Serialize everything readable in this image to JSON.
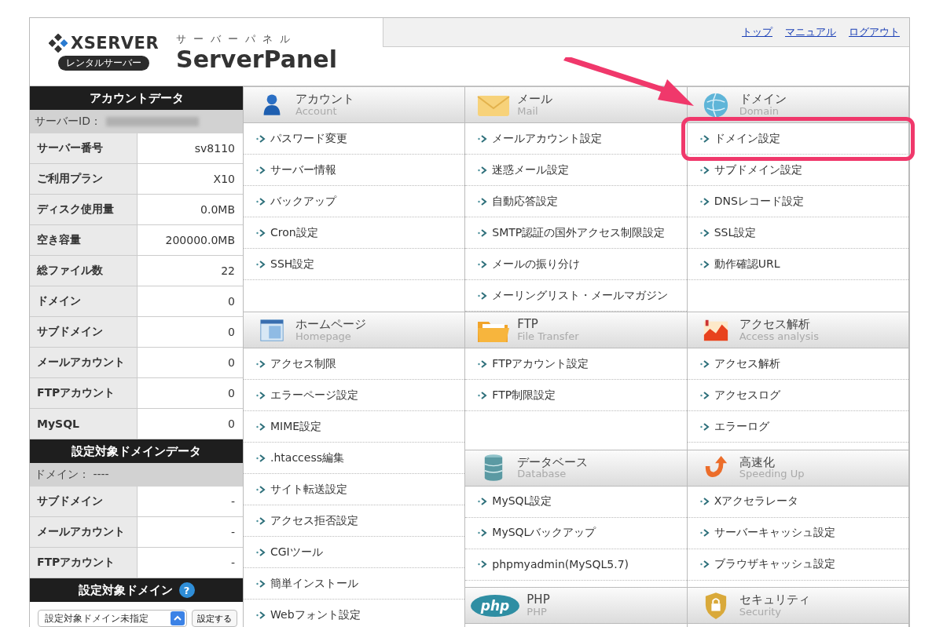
{
  "logo": {
    "brand": "XSERVER",
    "badge": "レンタルサーバー",
    "kana": "サーバーパネル",
    "product": "ServerPanel"
  },
  "top_links": [
    "トップ",
    "マニュアル",
    "ログアウト"
  ],
  "sidebar": [
    {
      "title": "アカウントデータ",
      "id_label": "サーバーID：",
      "id_redacted": true,
      "rows": [
        {
          "label": "サーバー番号",
          "value": "sv8110"
        },
        {
          "label": "ご利用プラン",
          "value": "X10"
        },
        {
          "label": "ディスク使用量",
          "value": "0.0MB"
        },
        {
          "label": "空き容量",
          "value": "200000.0MB"
        },
        {
          "label": "総ファイル数",
          "value": "22"
        },
        {
          "label": "ドメイン",
          "value": "0"
        },
        {
          "label": "サブドメイン",
          "value": "0"
        },
        {
          "label": "メールアカウント",
          "value": "0"
        },
        {
          "label": "FTPアカウント",
          "value": "0"
        },
        {
          "label": "MySQL",
          "value": "0"
        }
      ]
    },
    {
      "title": "設定対象ドメインデータ",
      "id_label": "ドメイン： ----",
      "id_redacted": false,
      "rows": [
        {
          "label": "サブドメイン",
          "value": "-"
        },
        {
          "label": "メールアカウント",
          "value": "-"
        },
        {
          "label": "FTPアカウント",
          "value": "-"
        }
      ]
    }
  ],
  "domain_picker": {
    "title": "設定対象ドメイン",
    "help": "?",
    "select_value": "設定対象ドメイン未指定",
    "button": "設定する"
  },
  "menu_columns": [
    [
      {
        "title": "アカウント",
        "subtitle": "Account",
        "items": [
          {
            "label": "パスワード変更",
            "highlighted": false
          },
          {
            "label": "サーバー情報",
            "highlighted": false
          },
          {
            "label": "バックアップ",
            "highlighted": false
          },
          {
            "label": "Cron設定",
            "highlighted": false
          },
          {
            "label": "SSH設定",
            "highlighted": false
          }
        ]
      },
      {
        "title": "ホームページ",
        "subtitle": "Homepage",
        "items": [
          {
            "label": "アクセス制限",
            "highlighted": false
          },
          {
            "label": "エラーページ設定",
            "highlighted": false
          },
          {
            "label": "MIME設定",
            "highlighted": false
          },
          {
            "label": ".htaccess編集",
            "highlighted": false
          },
          {
            "label": "サイト転送設定",
            "highlighted": false
          },
          {
            "label": "アクセス拒否設定",
            "highlighted": false
          },
          {
            "label": "CGIツール",
            "highlighted": false
          },
          {
            "label": "簡単インストール",
            "highlighted": false
          },
          {
            "label": "Webフォント設定",
            "highlighted": false
          }
        ]
      }
    ],
    [
      {
        "title": "メール",
        "subtitle": "Mail",
        "items": [
          {
            "label": "メールアカウント設定",
            "highlighted": false
          },
          {
            "label": "迷惑メール設定",
            "highlighted": false
          },
          {
            "label": "自動応答設定",
            "highlighted": false
          },
          {
            "label": "SMTP認証の国外アクセス制限設定",
            "highlighted": false
          },
          {
            "label": "メールの振り分け",
            "highlighted": false
          },
          {
            "label": "メーリングリスト・メールマガジン",
            "highlighted": false
          }
        ]
      },
      {
        "title": "FTP",
        "subtitle": "File Transfer",
        "items": [
          {
            "label": "FTPアカウント設定",
            "highlighted": false
          },
          {
            "label": "FTP制限設定",
            "highlighted": false
          }
        ]
      },
      {
        "title": "データベース",
        "subtitle": "Database",
        "items": [
          {
            "label": "MySQL設定",
            "highlighted": false
          },
          {
            "label": "MySQLバックアップ",
            "highlighted": false
          },
          {
            "label": "phpmyadmin(MySQL5.7)",
            "highlighted": false
          }
        ]
      },
      {
        "title": "PHP",
        "subtitle": "PHP",
        "icon_text": "php"
      }
    ],
    [
      {
        "title": "ドメイン",
        "subtitle": "Domain",
        "items": [
          {
            "label": "ドメイン設定",
            "highlighted": true
          },
          {
            "label": "サブドメイン設定",
            "highlighted": false
          },
          {
            "label": "DNSレコード設定",
            "highlighted": false
          },
          {
            "label": "SSL設定",
            "highlighted": false
          },
          {
            "label": "動作確認URL",
            "highlighted": false
          }
        ]
      },
      {
        "title": "アクセス解析",
        "subtitle": "Access analysis",
        "items": [
          {
            "label": "アクセス解析",
            "highlighted": false
          },
          {
            "label": "アクセスログ",
            "highlighted": false
          },
          {
            "label": "エラーログ",
            "highlighted": false
          }
        ]
      },
      {
        "title": "高速化",
        "subtitle": "Speeding Up",
        "items": [
          {
            "label": "Xアクセラレータ",
            "highlighted": false
          },
          {
            "label": "サーバーキャッシュ設定",
            "highlighted": false
          },
          {
            "label": "ブラウザキャッシュ設定",
            "highlighted": false
          }
        ]
      },
      {
        "title": "セキュリティ",
        "subtitle": "Security"
      }
    ]
  ],
  "annotation": {
    "color": "#f0386b"
  }
}
